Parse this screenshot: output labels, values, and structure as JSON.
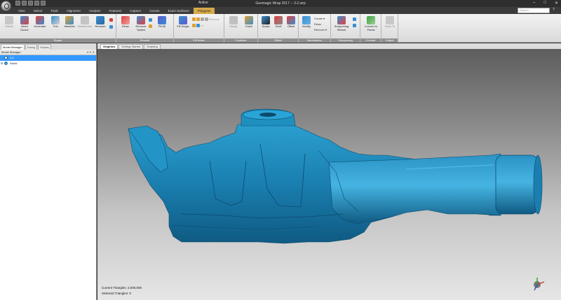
{
  "titlebar": {
    "app_title": "Geomagic Wrap 2017 -- 3-2.wrp",
    "context_label": "Active",
    "controls": {
      "minimize": "–",
      "maximize": "□",
      "close": "✕"
    }
  },
  "tabs": [
    "View",
    "Select",
    "Tools",
    "Alignment",
    "Analysis",
    "Features",
    "Capture",
    "Curves",
    "Exact Surfaces",
    "Polygons"
  ],
  "active_tab": "Polygons",
  "search_placeholder": "Search",
  "help": "?",
  "ribbon": {
    "repair": {
      "label": "Repair",
      "buttons": [
        "Delete",
        "Mesh Doctor",
        "Decimate",
        "Trim",
        "Manifold",
        "Refinement",
        "Remesh"
      ]
    },
    "smooth": {
      "label": "Smooth",
      "buttons": [
        "Relax",
        "Remove Spikes",
        "Fill All",
        "Fill Single"
      ]
    },
    "fill_holes": {
      "label": "Fill Holes",
      "small": [
        "Bridge",
        "Remove",
        "Pinch"
      ]
    },
    "combine": {
      "label": "Combine",
      "buttons": [
        "Merge",
        "Patch"
      ]
    },
    "offset": {
      "label": "Offset",
      "buttons": [
        "Sculpt",
        "Shell",
        "Offset"
      ]
    },
    "boundaries": {
      "label": "Boundaries",
      "buttons": [
        "Modify"
      ],
      "small": [
        "Create ▾",
        "Relax",
        "Remove ▾"
      ]
    },
    "sharpening": {
      "label": "Sharpening",
      "buttons": [
        "Sharpening Wizard"
      ]
    },
    "convert": {
      "label": "Convert",
      "buttons": [
        "Convert to Points"
      ]
    },
    "output": {
      "label": "Output",
      "buttons": [
        "Save To"
      ]
    }
  },
  "left_pane": {
    "tabs": [
      "Model Manager",
      "Dialog",
      "Display"
    ],
    "header": "Model Manager",
    "header_controls": "▾ ✦ ✕",
    "items": [
      {
        "label": "3-2",
        "selected": true,
        "expand": ""
      },
      {
        "label": "World",
        "selected": false,
        "expand": "⊞"
      }
    ]
  },
  "doc_tabs": [
    "Graphics",
    "Getting Started",
    "Scripting"
  ],
  "active_doc_tab": "Graphics",
  "status": {
    "triangles": "Current Triangles: 2,000,000",
    "selected": "Selected Triangles: 0"
  },
  "colors": {
    "model": "#1a7fb0",
    "active_tab": "#d8a94a",
    "selection": "#3399ff"
  }
}
